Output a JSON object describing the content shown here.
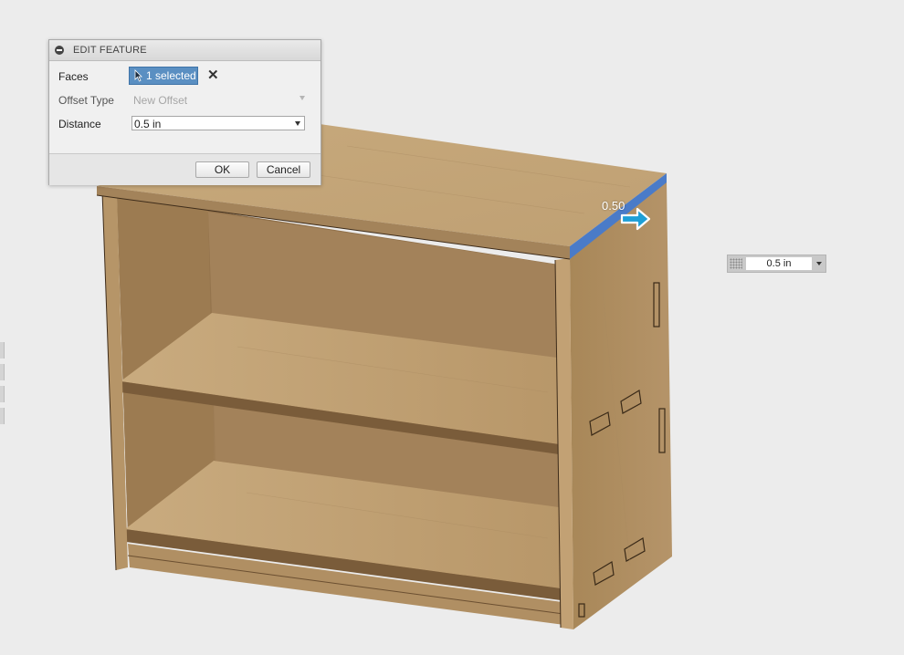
{
  "dialog": {
    "title": "EDIT FEATURE",
    "rows": {
      "faces": {
        "label": "Faces",
        "value": "1 selected"
      },
      "offset_type": {
        "label": "Offset Type",
        "value": "New Offset"
      },
      "distance": {
        "label": "Distance",
        "value": "0.5 in"
      }
    },
    "ok_label": "OK",
    "cancel_label": "Cancel"
  },
  "canvas": {
    "measure_label": "0.50",
    "distance_input": "0.5 in"
  },
  "colors": {
    "selection": "#4a7bc8",
    "wood_light": "#cdb189",
    "wood_mid": "#b08f63",
    "wood_dark": "#8e6f48",
    "arrow": "#1e9fd6"
  }
}
